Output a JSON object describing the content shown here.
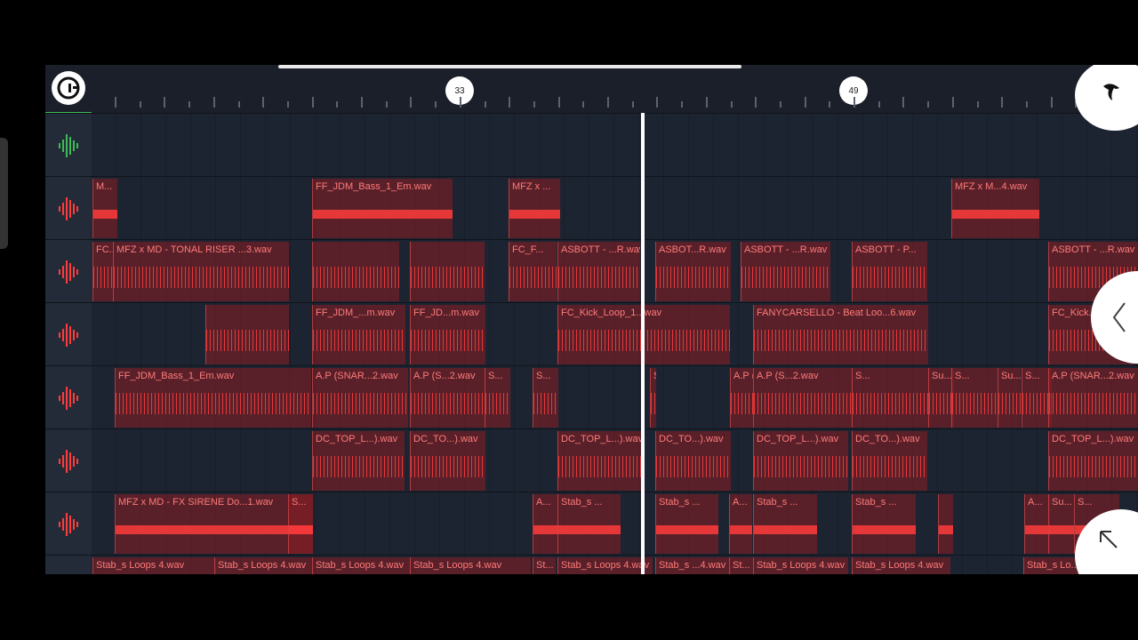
{
  "ruler": {
    "markers": [
      "33",
      "49"
    ]
  },
  "lanes": [
    {
      "clips": []
    },
    {
      "clips": [
        {
          "label": "M..."
        },
        {
          "label": "FF_JDM_Bass_1_Em.wav"
        },
        {
          "label": "MFZ  x ..."
        },
        {
          "label": "MFZ  x M...4.wav"
        }
      ]
    },
    {
      "clips": [
        {
          "label": "FC..."
        },
        {
          "label": "MFZ  x MD - TONAL RISER ...3.wav"
        },
        {
          "label": ""
        },
        {
          "label": ""
        },
        {
          "label": "FC_F..."
        },
        {
          "label": "ASBOTT - ...R.wav"
        },
        {
          "label": "ASBOT...R.wav"
        },
        {
          "label": "ASBOTT - ...R.wav"
        },
        {
          "label": "ASBOTT - P..."
        },
        {
          "label": "ASBOTT - ...R.wav"
        }
      ]
    },
    {
      "clips": [
        {
          "label": ""
        },
        {
          "label": "FF_JDM_...m.wav"
        },
        {
          "label": "FF_JD...m.wav"
        },
        {
          "label": "FC_Kick_Loop_1...wav"
        },
        {
          "label": "FANYCARSELLO - Beat Loo...6.wav"
        },
        {
          "label": "FC_Kick..."
        }
      ]
    },
    {
      "clips": [
        {
          "label": "FF_JDM_Bass_1_Em.wav"
        },
        {
          "label": "A.P (SNAR...2.wav"
        },
        {
          "label": "A.P (S...2.wav"
        },
        {
          "label": "S..."
        },
        {
          "label": "S..."
        },
        {
          "label": "S..."
        },
        {
          "label": "A.P (SNA...2.wav"
        },
        {
          "label": "A.P (S...2.wav"
        },
        {
          "label": "S..."
        },
        {
          "label": "Su..."
        },
        {
          "label": "S..."
        },
        {
          "label": "Su..."
        },
        {
          "label": "S..."
        },
        {
          "label": "A.P (SNAR...2.wav"
        }
      ]
    },
    {
      "clips": [
        {
          "label": "DC_TOP_L...).wav"
        },
        {
          "label": "DC_TO...).wav"
        },
        {
          "label": "DC_TOP_L...).wav"
        },
        {
          "label": "DC_TO...).wav"
        },
        {
          "label": "DC_TOP_L...).wav"
        },
        {
          "label": "DC_TO...).wav"
        },
        {
          "label": "DC_TOP_L...).wav"
        }
      ]
    },
    {
      "clips": [
        {
          "label": "MFZ  x MD - FX SIRENE Do...1.wav"
        },
        {
          "label": "S..."
        },
        {
          "label": "A..."
        },
        {
          "label": "Stab_s ..."
        },
        {
          "label": "Stab_s ..."
        },
        {
          "label": "A..."
        },
        {
          "label": "Stab_s ..."
        },
        {
          "label": "Stab_s ..."
        },
        {
          "label": ""
        },
        {
          "label": "A..."
        },
        {
          "label": "Su..."
        },
        {
          "label": "S..."
        }
      ]
    },
    {
      "clips": [
        {
          "label": "Stab_s Loops 4.wav"
        },
        {
          "label": "Stab_s Loops 4.wav"
        },
        {
          "label": "Stab_s Loops 4.wav"
        },
        {
          "label": "Stab_s Loops 4.wav"
        },
        {
          "label": "St..."
        },
        {
          "label": "Stab_s Loops 4.wav"
        },
        {
          "label": "Stab_s ...4.wav"
        },
        {
          "label": "St..."
        },
        {
          "label": "Stab_s Loops 4.wav"
        },
        {
          "label": "Stab_s Loops 4.wav"
        },
        {
          "label": "Stab_s Lo..."
        }
      ]
    }
  ],
  "colors": {
    "clip_text": "#ff7a7a",
    "wave": "#ff3b3b",
    "accent_green": "#3dbb55"
  }
}
